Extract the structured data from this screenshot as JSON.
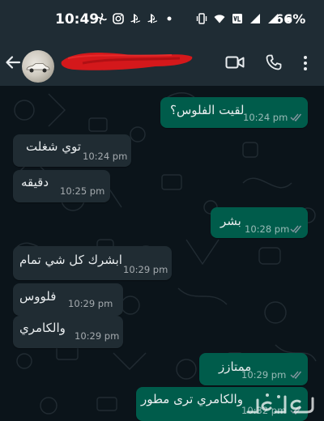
{
  "status_bar": {
    "time": "10:49",
    "battery": "66%",
    "left_icons": [
      "fan-icon",
      "instagram-icon",
      "playstation-icon",
      "playstation-icon",
      "dot-icon"
    ],
    "right_icons": [
      "vibrate-icon",
      "wifi-icon",
      "volte-icon",
      "signal-icon",
      "signal-icon"
    ]
  },
  "header": {
    "back_icon": "arrow-left-icon",
    "video_icon": "video-camera-icon",
    "call_icon": "phone-icon",
    "menu_icon": "more-vertical-icon"
  },
  "colors": {
    "outgoing_bubble": "#005c4b",
    "incoming_bubble": "#202c33",
    "background": "#0b141a",
    "header": "#1f2c34",
    "read_ticks": "#8696a0"
  },
  "messages": [
    {
      "direction": "out",
      "text": "لقيت الفلوس؟",
      "time": "10:24 pm",
      "ticks": true
    },
    {
      "direction": "in",
      "text": "توي شغلت",
      "time": "10:24 pm",
      "ticks": false
    },
    {
      "direction": "in",
      "text": "دقيقه",
      "time": "10:25 pm",
      "ticks": false
    },
    {
      "direction": "out",
      "text": "بشر",
      "time": "10:28 pm",
      "ticks": true
    },
    {
      "direction": "in",
      "text": "ابشرك كل شي تمام",
      "time": "10:29 pm",
      "ticks": false
    },
    {
      "direction": "in",
      "text": "فلووس",
      "time": "10:29 pm",
      "ticks": false
    },
    {
      "direction": "in",
      "text": "والكامري",
      "time": "10:29 pm",
      "ticks": false
    },
    {
      "direction": "out",
      "text": "ممتازز",
      "time": "10:29 pm",
      "ticks": true
    },
    {
      "direction": "out",
      "text": "والكامري ترى مطور",
      "time": "10:32 pm",
      "ticks": true
    }
  ]
}
